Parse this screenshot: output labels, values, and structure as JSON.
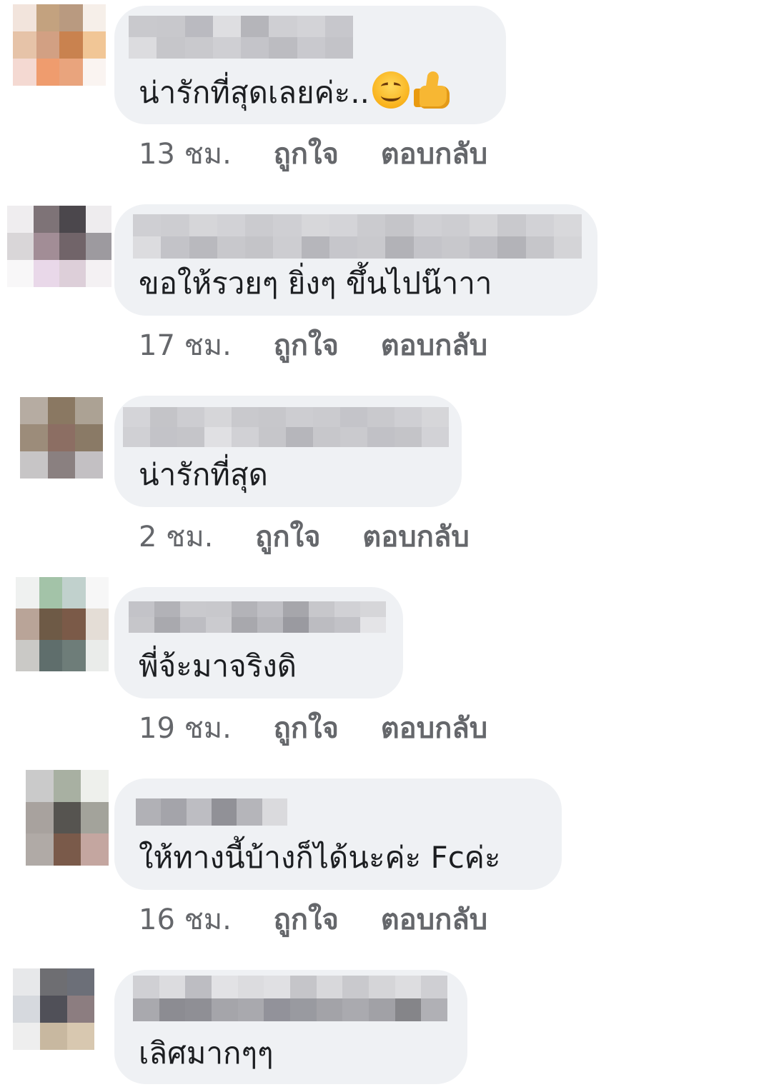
{
  "comments": [
    {
      "text": "น่ารักที่สุดเลยค่ะ..",
      "emojis": [
        "smiling-face",
        "thumbs-up"
      ],
      "time": "13 ชม.",
      "like": "ถูกใจ",
      "reply": "ตอบกลับ"
    },
    {
      "text": "ขอให้รวยๆ ยิ่งๆ ขึ้นไปน๊าาา",
      "time": "17 ชม.",
      "like": "ถูกใจ",
      "reply": "ตอบกลับ"
    },
    {
      "text": "น่ารักที่สุด",
      "time": "2 ชม.",
      "like": "ถูกใจ",
      "reply": "ตอบกลับ"
    },
    {
      "text": "พี่จ้ะมาจริงดิ",
      "time": "19 ชม.",
      "like": "ถูกใจ",
      "reply": "ตอบกลับ"
    },
    {
      "text": "ให้ทางนี้บ้างก็ได้นะค่ะ Fcค่ะ",
      "time": "16 ชม.",
      "like": "ถูกใจ",
      "reply": "ตอบกลับ"
    },
    {
      "text": "เลิศมากๆๆ"
    }
  ],
  "colors": {
    "bubble": "#eff1f4",
    "comment_text": "#1c1e21",
    "meta_text": "#65676b"
  }
}
